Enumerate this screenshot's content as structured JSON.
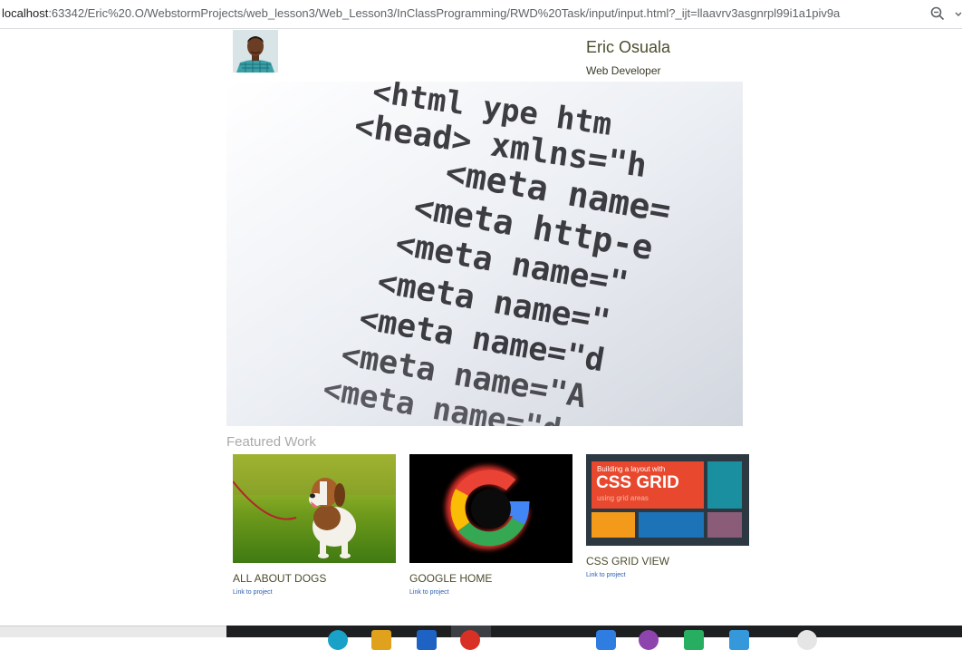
{
  "browser": {
    "url_host": "localhost",
    "url_rest": ":63342/Eric%20.O/WebstormProjects/web_lesson3/Web_Lesson3/InClassProgramming/RWD%20Task/input/input.html?_ijt=llaavrv3asgnrpl99i1a1piv9a",
    "zoom_icon": "magnifier-icon",
    "menu_icon": "more-icon"
  },
  "profile": {
    "name": "Eric Osuala",
    "role": "Web Developer"
  },
  "hero": {
    "code_lines": [
      "<html  ype htm",
      "<head>  xmlns=\"h",
      "<meta  name=",
      "<meta  http-e",
      "<meta  name=\"",
      "<meta  name=\"",
      "<meta  name=\"d",
      "<meta  name=\"A",
      "<meta  name=\"d"
    ]
  },
  "featured": {
    "heading": "Featured Work",
    "projects": [
      {
        "title": "ALL ABOUT DOGS",
        "link": "Link to project"
      },
      {
        "title": "GOOGLE HOME",
        "link": "Link to project"
      },
      {
        "title": "CSS GRID VIEW",
        "link": "Link to project",
        "banner_line1": "Building a layout with",
        "banner_line2": "CSS GRID",
        "banner_line3": "using grid areas"
      }
    ]
  },
  "colors": {
    "text_olive": "#4d4d2e",
    "link_blue": "#2a5db0",
    "muted_gray": "#aaaaaa"
  }
}
